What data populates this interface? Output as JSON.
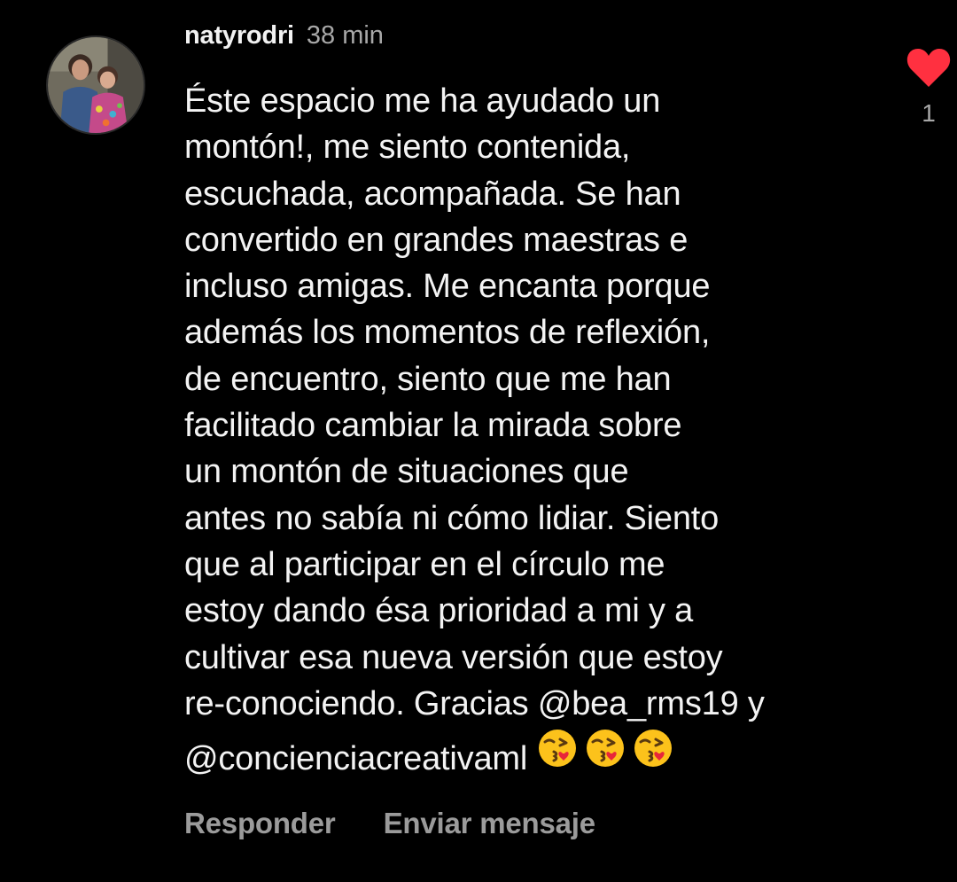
{
  "comment": {
    "username": "natyrodri",
    "time": "38 min",
    "lines": [
      "Éste espacio me ha ayudado un",
      "montón!, me siento contenida,",
      "escuchada, acompañada. Se han",
      "convertido en grandes maestras e",
      "incluso amigas. Me encanta porque",
      "además los momentos de reflexión,",
      "de encuentro, siento que me han",
      "facilitado cambiar la mirada sobre",
      "un montón de situaciones que",
      "antes no sabía ni cómo lidiar. Siento",
      "que al participar en el círculo me",
      "estoy dando ésa prioridad a mi y a",
      "cultivar esa nueva versión que estoy",
      "re-conociendo. Gracias @bea_rms19 y",
      "@concienciacreativaml"
    ],
    "emojis": [
      "kissing-face-heart-icon",
      "kissing-face-heart-icon",
      "kissing-face-heart-icon"
    ],
    "like_count": "1",
    "like_color": "#ff3040"
  },
  "actions": {
    "reply_label": "Responder",
    "send_message_label": "Enviar mensaje"
  },
  "colors": {
    "background": "#000000",
    "text": "#f3f3f3",
    "muted": "#a8a8a8"
  }
}
